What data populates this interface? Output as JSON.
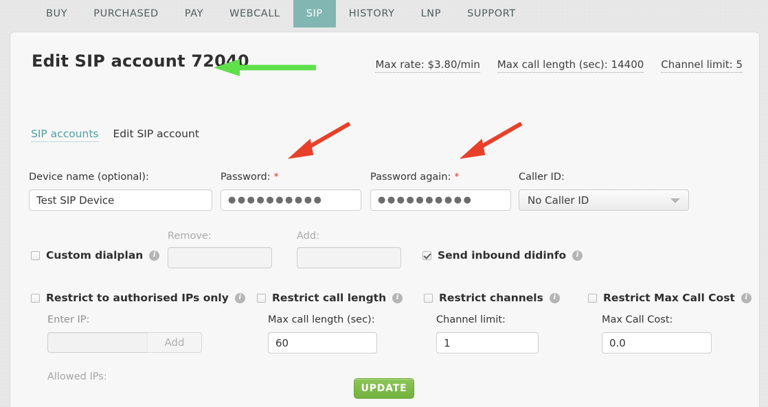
{
  "nav": {
    "items": [
      {
        "label": "BUY",
        "active": false
      },
      {
        "label": "PURCHASED",
        "active": false
      },
      {
        "label": "PAY",
        "active": false
      },
      {
        "label": "WEBCALL",
        "active": false
      },
      {
        "label": "SIP",
        "active": true
      },
      {
        "label": "HISTORY",
        "active": false
      },
      {
        "label": "LNP",
        "active": false
      },
      {
        "label": "SUPPORT",
        "active": false
      }
    ],
    "active_color": "#82b6b2"
  },
  "header": {
    "title": "Edit SIP account 72040",
    "meta": [
      "Max rate: $3.80/min",
      "Max call length (sec): 14400",
      "Channel limit: 5"
    ]
  },
  "breadcrumbs": [
    {
      "label": "SIP accounts",
      "is_link": true
    },
    {
      "label": "Edit SIP account",
      "is_link": false
    }
  ],
  "form": {
    "device_name": {
      "label": "Device name (optional):",
      "value": "Test SIP Device"
    },
    "password": {
      "label": "Password:",
      "required_mark": "*",
      "value": "●●●●●●●●●●"
    },
    "password_again": {
      "label": "Password again:",
      "required_mark": "*",
      "value": "●●●●●●●●●●"
    },
    "caller_id": {
      "label": "Caller ID:",
      "value": "No Caller ID",
      "options": [
        "No Caller ID"
      ]
    },
    "custom_dialplan": {
      "label": "Custom dialplan",
      "checked": false,
      "info": "i"
    },
    "dialplan_remove": {
      "label": "Remove:",
      "value": "",
      "disabled": true
    },
    "dialplan_add": {
      "label": "Add:",
      "value": "",
      "disabled": true
    },
    "send_inbound_didinfo": {
      "label": "Send inbound didinfo",
      "checked": true,
      "info": "i"
    },
    "restrict_ips": {
      "label": "Restrict to authorised IPs only",
      "checked": false,
      "info": "i"
    },
    "enter_ip": {
      "label": "Enter IP:",
      "value": "",
      "button_label": "Add",
      "disabled": true
    },
    "allowed_ips": {
      "label": "Allowed IPs:"
    },
    "restrict_call_length": {
      "label": "Restrict call length",
      "checked": false,
      "info": "i"
    },
    "max_call_length": {
      "label": "Max call length (sec):",
      "value": "60"
    },
    "restrict_channels": {
      "label": "Restrict channels",
      "checked": false,
      "info": "i"
    },
    "channel_limit": {
      "label": "Channel limit:",
      "value": "1"
    },
    "restrict_max_call_cost": {
      "label": "Restrict Max Call Cost",
      "checked": false,
      "info": "i"
    },
    "max_call_cost": {
      "label": "Max Call Cost:",
      "value": "0.0"
    }
  },
  "actions": {
    "update_label": "UPDATE"
  },
  "annotations": {
    "green_arrow_color": "#5FE04B",
    "red_arrow_color": "#E8402A"
  }
}
